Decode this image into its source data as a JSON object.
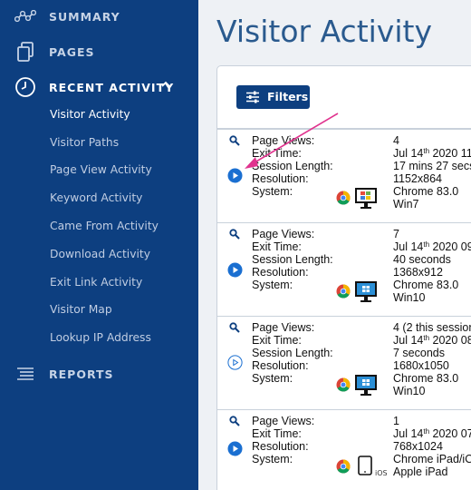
{
  "sidebar": {
    "summary": "SUMMARY",
    "pages": "PAGES",
    "recent_activity": "RECENT ACTIVITY",
    "reports": "REPORTS",
    "sub_items": [
      "Visitor Activity",
      "Visitor Paths",
      "Page View Activity",
      "Keyword Activity",
      "Came From Activity",
      "Download Activity",
      "Exit Link Activity",
      "Visitor Map",
      "Lookup IP Address"
    ]
  },
  "main": {
    "title": "Visitor Activity",
    "filters_label": "Filters"
  },
  "labels": {
    "page_views": "Page Views:",
    "exit_time": "Exit Time:",
    "session_length": "Session Length:",
    "resolution": "Resolution:",
    "system": "System:"
  },
  "sessions": [
    {
      "page_views": "4",
      "exit_time": "Jul 14",
      "exit_time_sup": "th",
      "exit_time_rest": " 2020 11",
      "session_length": "17 mins 27 secs",
      "resolution": "1152x864",
      "browser": "Chrome 83.0",
      "os": "Win7",
      "device_icon": "monitor-win7-icon"
    },
    {
      "page_views": "7",
      "exit_time": "Jul 14",
      "exit_time_sup": "th",
      "exit_time_rest": " 2020 09",
      "session_length": "40 seconds",
      "resolution": "1368x912",
      "browser": "Chrome 83.0",
      "os": "Win10",
      "device_icon": "monitor-win10-icon"
    },
    {
      "page_views": "4 (2 this session",
      "exit_time": "Jul 14",
      "exit_time_sup": "th",
      "exit_time_rest": " 2020 08",
      "session_length": "7 seconds",
      "resolution": "1680x1050",
      "browser": "Chrome 83.0",
      "os": "Win10",
      "device_icon": "monitor-win10-icon"
    },
    {
      "page_views": "1",
      "exit_time": "Jul 14",
      "exit_time_sup": "th",
      "exit_time_rest": " 2020 07",
      "resolution": "768x1024",
      "browser": "Chrome iPad/iO",
      "os": "Apple iPad",
      "device_icon": "ipad-icon",
      "ios_label": "iOS"
    }
  ],
  "colors": {
    "sidebar": "#0d3f80",
    "accent": "#1a6fd1",
    "title": "#2a5a8e",
    "annotation_arrow": "#e0338e"
  }
}
